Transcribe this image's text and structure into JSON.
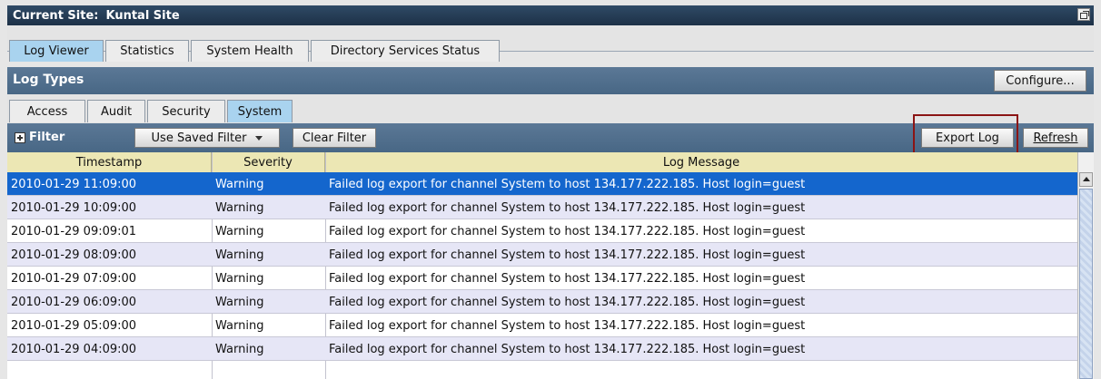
{
  "window": {
    "title_label": "Current Site:",
    "site_name": "Kuntal Site",
    "restore_icon": "restore-window-icon"
  },
  "top_tabs": [
    {
      "label": "Log Viewer",
      "active": true
    },
    {
      "label": "Statistics",
      "active": false
    },
    {
      "label": "System Health",
      "active": false
    },
    {
      "label": "Directory Services Status",
      "active": false
    }
  ],
  "log_types": {
    "title": "Log Types",
    "configure_label": "Configure..."
  },
  "log_type_tabs": [
    {
      "label": "Access",
      "active": false
    },
    {
      "label": "Audit",
      "active": false
    },
    {
      "label": "Security",
      "active": false
    },
    {
      "label": "System",
      "active": true
    }
  ],
  "filter": {
    "label": "Filter",
    "saved_filter_label": "Use Saved Filter",
    "clear_label": "Clear Filter",
    "export_label": "Export Log",
    "refresh_label": "Refresh"
  },
  "table": {
    "columns": [
      "Timestamp",
      "Severity",
      "Log Message"
    ],
    "rows": [
      {
        "timestamp": "2010-01-29 11:09:00",
        "severity": "Warning",
        "message": "Failed log export for channel System to host 134.177.222.185.  Host login=guest",
        "selected": true
      },
      {
        "timestamp": "2010-01-29 10:09:00",
        "severity": "Warning",
        "message": "Failed log export for channel System to host 134.177.222.185.  Host login=guest",
        "selected": false
      },
      {
        "timestamp": "2010-01-29 09:09:01",
        "severity": "Warning",
        "message": "Failed log export for channel System to host 134.177.222.185.  Host login=guest",
        "selected": false
      },
      {
        "timestamp": "2010-01-29 08:09:00",
        "severity": "Warning",
        "message": "Failed log export for channel System to host 134.177.222.185.  Host login=guest",
        "selected": false
      },
      {
        "timestamp": "2010-01-29 07:09:00",
        "severity": "Warning",
        "message": "Failed log export for channel System to host 134.177.222.185.  Host login=guest",
        "selected": false
      },
      {
        "timestamp": "2010-01-29 06:09:00",
        "severity": "Warning",
        "message": "Failed log export for channel System to host 134.177.222.185.  Host login=guest",
        "selected": false
      },
      {
        "timestamp": "2010-01-29 05:09:00",
        "severity": "Warning",
        "message": "Failed log export for channel System to host 134.177.222.185.  Host login=guest",
        "selected": false
      },
      {
        "timestamp": "2010-01-29 04:09:00",
        "severity": "Warning",
        "message": "Failed log export for channel System to host 134.177.222.185.  Host login=guest",
        "selected": false
      }
    ]
  },
  "colors": {
    "title_bar": "#1d3147",
    "section_bar": "#486785",
    "active_tab": "#a9d3ef",
    "selected_row": "#1466cd",
    "alt_row": "#e6e6f6",
    "header_bg": "#ece7b4",
    "highlight_box": "#8b1414"
  }
}
